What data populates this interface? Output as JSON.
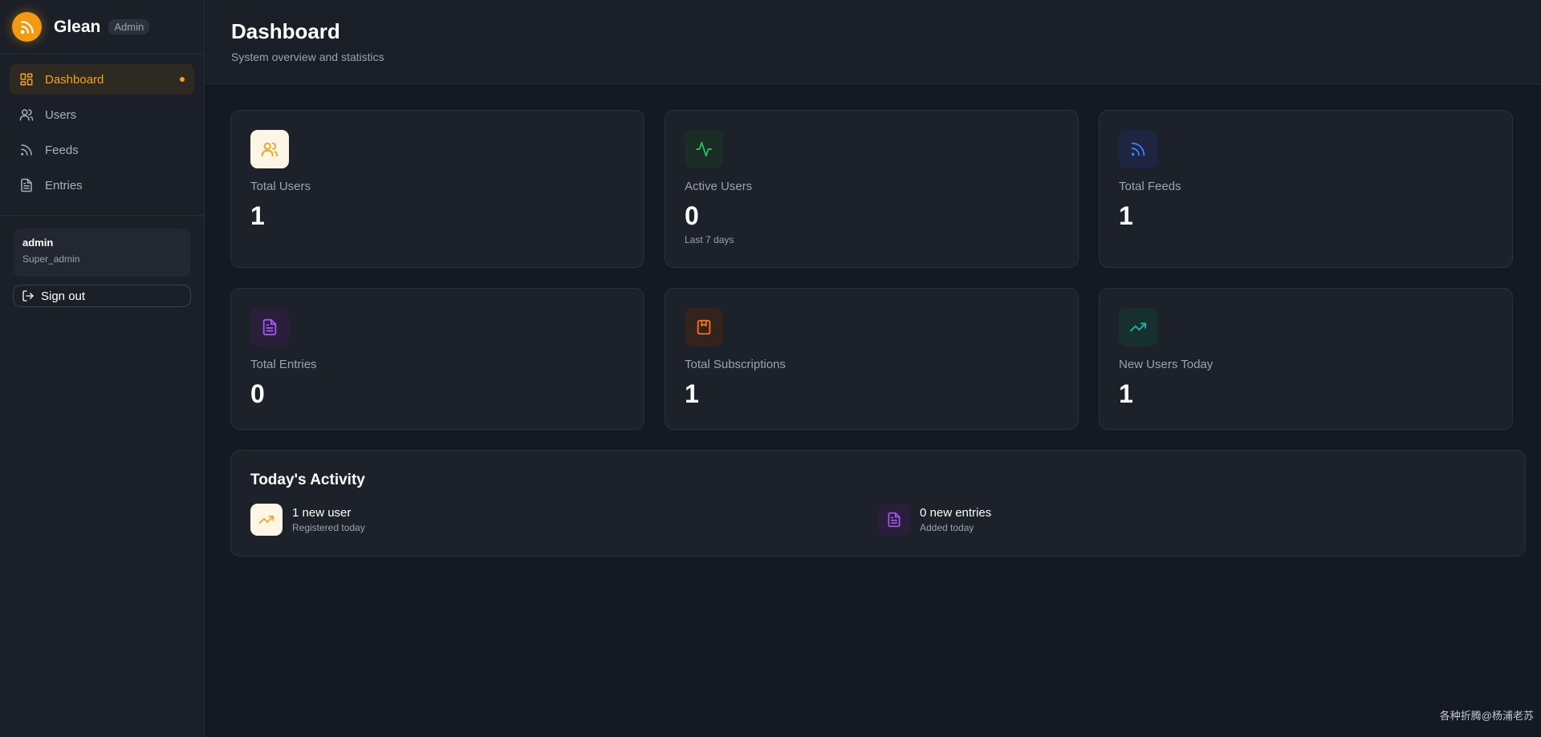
{
  "brand": {
    "name": "Glean",
    "badge": "Admin"
  },
  "sidebar": {
    "items": [
      {
        "label": "Dashboard",
        "icon": "dashboard-icon",
        "active": true
      },
      {
        "label": "Users",
        "icon": "users-icon",
        "active": false
      },
      {
        "label": "Feeds",
        "icon": "rss-icon",
        "active": false
      },
      {
        "label": "Entries",
        "icon": "document-icon",
        "active": false
      }
    ],
    "user": {
      "name": "admin",
      "role": "Super_admin"
    },
    "signout_label": "Sign out"
  },
  "header": {
    "title": "Dashboard",
    "subtitle": "System overview and statistics"
  },
  "stats": [
    {
      "label": "Total Users",
      "value": "1",
      "icon": "users-icon",
      "color": "#f3a21a"
    },
    {
      "label": "Active Users",
      "value": "0",
      "note": "Last 7 days",
      "icon": "activity-icon",
      "color": "#22c55e"
    },
    {
      "label": "Total Feeds",
      "value": "1",
      "icon": "rss-icon",
      "color": "#3b82f6"
    },
    {
      "label": "Total Entries",
      "value": "0",
      "icon": "document-icon",
      "color": "#a855f7"
    },
    {
      "label": "Total Subscriptions",
      "value": "1",
      "icon": "bookmark-icon",
      "color": "#f97316"
    },
    {
      "label": "New Users Today",
      "value": "1",
      "icon": "trending-up-icon",
      "color": "#14b8a6"
    }
  ],
  "activity": {
    "title": "Today's Activity",
    "items": [
      {
        "main": "1 new user",
        "sub": "Registered today",
        "icon": "trending-up-icon",
        "color": "#f3a21a"
      },
      {
        "main": "0 new entries",
        "sub": "Added today",
        "icon": "document-icon",
        "color": "#a855f7"
      }
    ]
  },
  "watermark": "各种折腾@杨浦老苏",
  "colors": {
    "accent": "#f3a21a",
    "background": "#151921",
    "card": "#1d2129"
  }
}
